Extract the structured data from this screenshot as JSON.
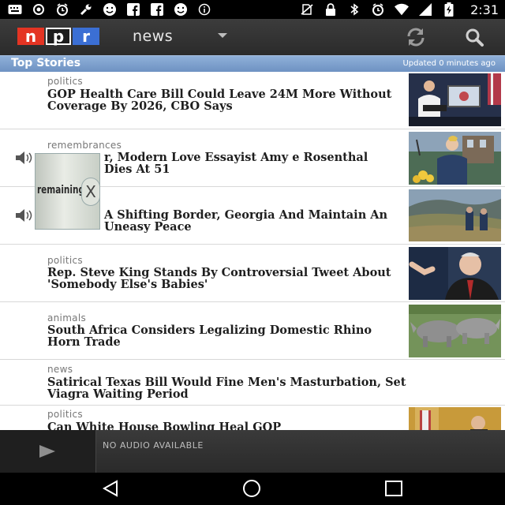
{
  "status_bar": {
    "left_icons": [
      "keyboard-icon",
      "circle-dot-icon",
      "alarm-icon",
      "wrench-icon",
      "smiley-icon",
      "facebook-icon",
      "facebook-icon",
      "smiley-icon",
      "info-icon",
      "no-sim-icon",
      "lock-icon",
      "bluetooth-icon",
      "alarm-icon",
      "wifi-icon",
      "battery-charging-icon"
    ],
    "time": "2:31"
  },
  "app_bar": {
    "logo_letters": [
      "n",
      "p",
      "r"
    ],
    "title": "news"
  },
  "section": {
    "title": "Top Stories",
    "updated": "Updated 0 minutes ago"
  },
  "stories": [
    {
      "category": "politics",
      "headline": "GOP Health Care Bill Could Leave 24M More Without Coverage By 2026, CBO Says"
    },
    {
      "category": "remembrances",
      "headline": "r, Modern Love Essayist Amy e Rosenthal Dies At 51"
    },
    {
      "category": "",
      "headline": "A Shifting Border, Georgia And Maintain An Uneasy Peace"
    },
    {
      "category": "politics",
      "headline": "Rep. Steve King Stands By Controversial Tweet About 'Somebody Else's Babies'"
    },
    {
      "category": "animals",
      "headline": "South Africa Considers Legalizing Domestic Rhino Horn Trade"
    },
    {
      "category": "news",
      "headline": "Satirical Texas Bill Would Fine Men's Masturbation, Set Viagra Waiting Period"
    },
    {
      "category": "politics",
      "headline": "Can White House Bowling Heal GOP"
    }
  ],
  "overlay": {
    "text": "remaining",
    "close_label": "X"
  },
  "player": {
    "status": "NO AUDIO AVAILABLE"
  },
  "colors": {
    "npr_red": "#e43423",
    "npr_blue": "#3b6fd4",
    "section_blue": "#7a9bc9"
  }
}
